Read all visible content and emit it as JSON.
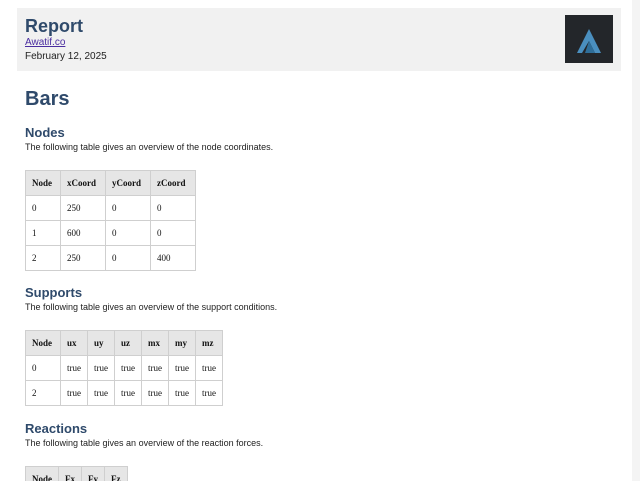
{
  "header": {
    "title": "Report",
    "link": "Awatif.co",
    "date": "February 12, 2025",
    "logo_icon": "awatif-logo-icon",
    "logo_bg": "#23262a",
    "logo_mark_color": "#4a8fbf"
  },
  "page": {
    "title": "Bars"
  },
  "nodes": {
    "heading": "Nodes",
    "description": "The following table gives an overview of the node coordinates.",
    "columns": [
      "Node",
      "xCoord",
      "yCoord",
      "zCoord"
    ],
    "rows": [
      [
        "0",
        "250",
        "0",
        "0"
      ],
      [
        "1",
        "600",
        "0",
        "0"
      ],
      [
        "2",
        "250",
        "0",
        "400"
      ]
    ]
  },
  "supports": {
    "heading": "Supports",
    "description": "The following table gives an overview of the support conditions.",
    "columns": [
      "Node",
      "ux",
      "uy",
      "uz",
      "mx",
      "my",
      "mz"
    ],
    "rows": [
      [
        "0",
        "true",
        "true",
        "true",
        "true",
        "true",
        "true"
      ],
      [
        "2",
        "true",
        "true",
        "true",
        "true",
        "true",
        "true"
      ]
    ]
  },
  "reactions": {
    "heading": "Reactions",
    "description": "The following table gives an overview of the reaction forces.",
    "columns": [
      "Node",
      "Fx",
      "Fy",
      "Fz"
    ]
  },
  "colors": {
    "heading": "#2f4a6b",
    "header_bg": "#f1f1f1",
    "table_header_bg": "#e6e6e6"
  }
}
